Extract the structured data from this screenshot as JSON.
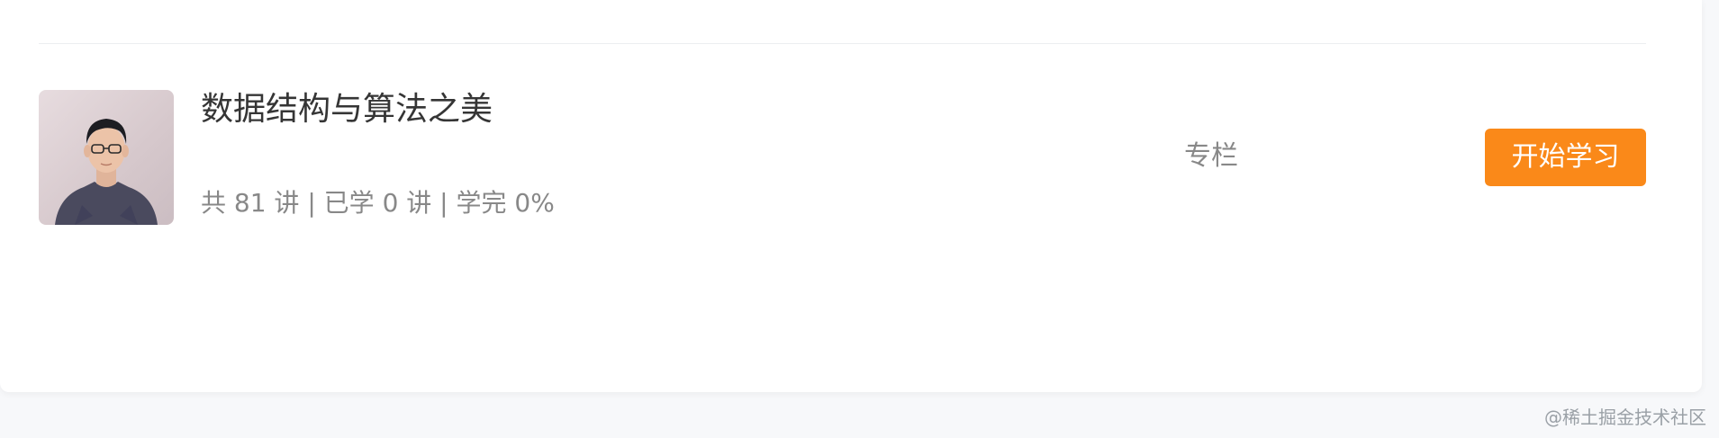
{
  "course": {
    "title": "数据结构与算法之美",
    "meta": "共 81 讲 | 已学 0 讲 | 学完 0%",
    "type_label": "专栏",
    "action_label": "开始学习"
  },
  "watermark": "@稀土掘金技术社区",
  "colors": {
    "accent": "#fa8919",
    "title": "#353535",
    "muted": "#888888"
  },
  "icons": {
    "avatar": "author-photo"
  }
}
